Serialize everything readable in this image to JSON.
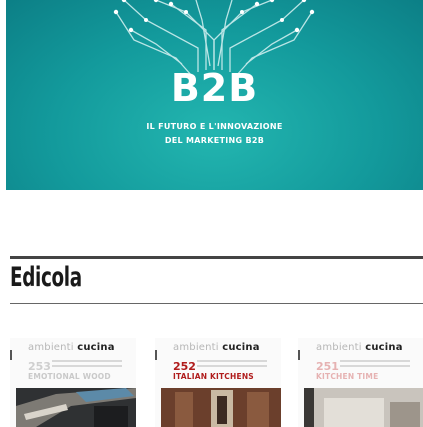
{
  "banner": {
    "title": "B2B",
    "subtitle_line1": "IL FUTURO E L'INNOVAZIONE",
    "subtitle_line2": "DEL MARKETING B2B",
    "colors": {
      "background": "#139a9c",
      "text": "#ffffff"
    },
    "decoration": "circuit-tree-illustration"
  },
  "section": {
    "title": "Edicola"
  },
  "magazines": [
    {
      "masthead_light": "ambienti",
      "masthead_bold": "cucina",
      "issue": "253",
      "headline": "EMOTIONAL WOOD"
    },
    {
      "masthead_light": "ambienti",
      "masthead_bold": "cucina",
      "issue": "252",
      "headline": "ITALIAN KITCHENS",
      "accent": "#b01c1c"
    },
    {
      "masthead_light": "ambienti",
      "masthead_bold": "cucina",
      "issue": "251",
      "headline": "KITCHEN TIME"
    }
  ]
}
